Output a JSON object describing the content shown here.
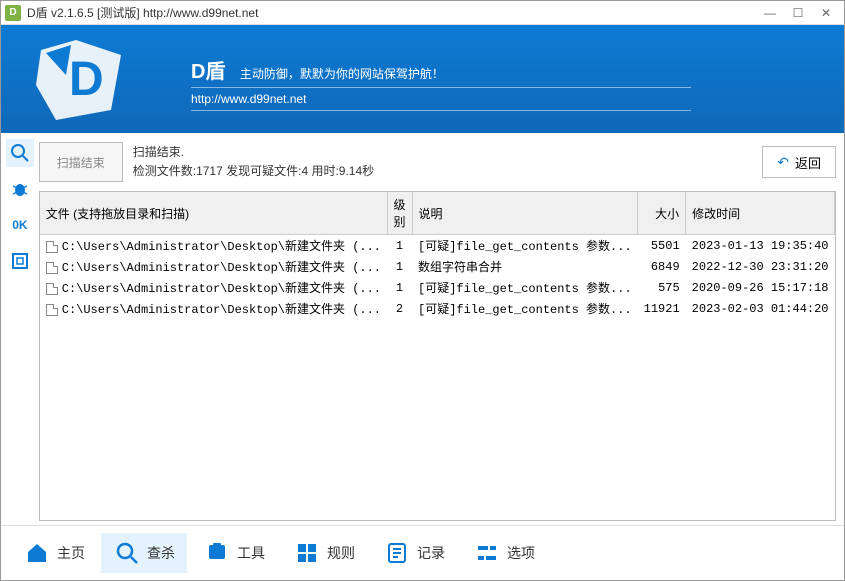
{
  "window": {
    "title": "D盾 v2.1.6.5 [测试版] http://www.d99net.net"
  },
  "banner": {
    "title": "D盾",
    "subtitle": "主动防御，默默为你的网站保驾护航！",
    "url": "http://www.d99net.net"
  },
  "side": {
    "ok": "0K"
  },
  "status": {
    "button": "扫描结束",
    "line1": "扫描结束.",
    "line2": "检测文件数:1717 发现可疑文件:4 用时:9.14秒",
    "return": "返回"
  },
  "table": {
    "headers": {
      "file": "文件 (支持拖放目录和扫描)",
      "level": "级别",
      "desc": "说明",
      "size": "大小",
      "time": "修改时间"
    },
    "rows": [
      {
        "file": "C:\\Users\\Administrator\\Desktop\\新建文件夹 (...",
        "level": "1",
        "desc": "[可疑]file_get_contents 参数...",
        "size": "5501",
        "time": "2023-01-13 19:35:40"
      },
      {
        "file": "C:\\Users\\Administrator\\Desktop\\新建文件夹 (...",
        "level": "1",
        "desc": "数组字符串合并",
        "size": "6849",
        "time": "2022-12-30 23:31:20"
      },
      {
        "file": "C:\\Users\\Administrator\\Desktop\\新建文件夹 (...",
        "level": "1",
        "desc": "[可疑]file_get_contents 参数...",
        "size": "575",
        "time": "2020-09-26 15:17:18"
      },
      {
        "file": "C:\\Users\\Administrator\\Desktop\\新建文件夹 (...",
        "level": "2",
        "desc": "[可疑]file_get_contents 参数...",
        "size": "11921",
        "time": "2023-02-03 01:44:20"
      }
    ]
  },
  "nav": {
    "home": "主页",
    "scan": "查杀",
    "tools": "工具",
    "rules": "规则",
    "log": "记录",
    "options": "选项"
  }
}
